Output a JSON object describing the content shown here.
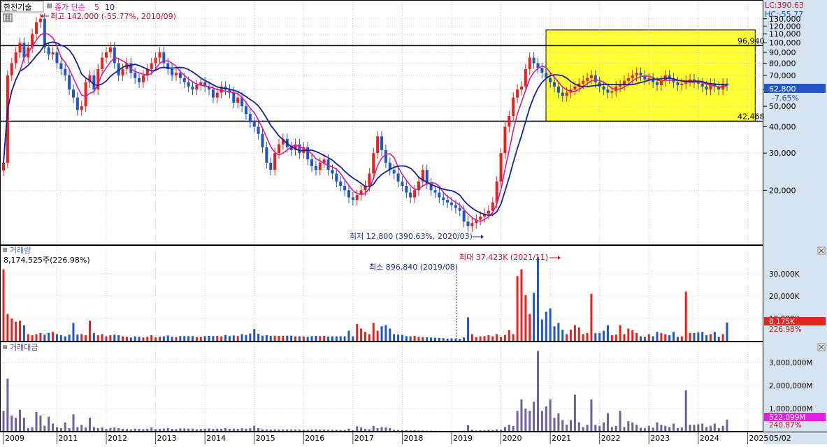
{
  "header": {
    "stock_name": "한전기술",
    "ma_legend_label": "종가 단순",
    "ma_periods": [
      "5",
      "10"
    ],
    "max_label": "최고 142,000 (-55.77%, 2010/09)",
    "min_label": "최저 12,800 (390.63%, 2020/03)",
    "lc_label": "LC:390.63",
    "hc_label": "HC:-55.77"
  },
  "colors": {
    "up": "#e8211e",
    "down": "#1f55c8",
    "ma5": "#d81aa8",
    "ma10": "#14238f",
    "highlight": "#ffff33",
    "price_badge": "#2356c5",
    "volume_badge": "#e0261e",
    "amount_badge": "#e020e0",
    "amount_bar": "#6f5f9a",
    "axis_bg": "#d6e4f1"
  },
  "price_panel": {
    "scale": "log",
    "ylim": [
      11500,
      150000
    ],
    "ticks": [
      {
        "v": 20000,
        "label": "20,000"
      },
      {
        "v": 30000,
        "label": "30,000"
      },
      {
        "v": 40000,
        "label": "40,000"
      },
      {
        "v": 50000,
        "label": "50,000"
      },
      {
        "v": 60000,
        "label": "60,000"
      },
      {
        "v": 70000,
        "label": "70,000"
      },
      {
        "v": 80000,
        "label": "80,000"
      },
      {
        "v": 90000,
        "label": "90,000"
      },
      {
        "v": 100000,
        "label": "100,000"
      },
      {
        "v": 110000,
        "label": "110,000"
      },
      {
        "v": 120000,
        "label": "120,000"
      },
      {
        "v": 130000,
        "label": "130,000"
      }
    ],
    "hlines": [
      {
        "value": 96940,
        "label": "96,940"
      },
      {
        "value": 42468,
        "label": "42,468"
      }
    ],
    "highlight_box": {
      "x_from": "2021/02",
      "x_to": "2025/02",
      "y_from": 42468,
      "y_to": 115000
    },
    "current_price": {
      "value": 62800,
      "label": "62,800",
      "change": "-7.65%"
    }
  },
  "volume_panel": {
    "title": "거래량",
    "current_label": "8,174,525주(226.98%)",
    "max_label": "최대 37,423K (2021/11)",
    "min_label": "최소 896,840 (2019/08)",
    "ylim": [
      0,
      40000
    ],
    "ticks": [
      {
        "v": 10000,
        "label": "10,000K"
      },
      {
        "v": 20000,
        "label": "20,000K"
      },
      {
        "v": 30000,
        "label": "30,000K"
      }
    ],
    "badge_value": "8,175K",
    "badge_pct": "226.98%"
  },
  "amount_panel": {
    "title": "거래대금",
    "ylim": [
      0,
      3700
    ],
    "ticks": [
      {
        "v": 1000,
        "label": "1,000,000M"
      },
      {
        "v": 2000,
        "label": "2,000,000M"
      },
      {
        "v": 3000,
        "label": "3,000,000M"
      }
    ],
    "badge_value": "522,099M",
    "badge_pct": "240.87%"
  },
  "x_axis": {
    "year_labels": [
      "2009",
      "2011",
      "2012",
      "2013",
      "2014",
      "2015",
      "2016",
      "2017",
      "2018",
      "2019",
      "2020",
      "2021",
      "2022",
      "2023",
      "2024",
      "2025"
    ],
    "last_date_label": "05/02"
  },
  "chart_data": {
    "type": "candlestick",
    "interval": "monthly",
    "start": "2009/12",
    "end": "2025/05",
    "scale": "log",
    "close": [
      27000,
      70000,
      80000,
      90000,
      100000,
      85000,
      95000,
      110000,
      125000,
      130000,
      95000,
      88000,
      90000,
      80000,
      75000,
      70000,
      60000,
      55000,
      48000,
      50000,
      65000,
      70000,
      60000,
      75000,
      85000,
      90000,
      95000,
      80000,
      70000,
      75000,
      80000,
      72000,
      68000,
      65000,
      70000,
      75000,
      80000,
      85000,
      90000,
      80000,
      75000,
      70000,
      72000,
      68000,
      65000,
      62000,
      60000,
      63000,
      65000,
      62000,
      60000,
      55000,
      58000,
      62000,
      60000,
      58000,
      52000,
      55000,
      50000,
      46000,
      42000,
      40000,
      37000,
      32000,
      27000,
      25000,
      30000,
      33000,
      35000,
      32000,
      31000,
      33000,
      30000,
      32000,
      28000,
      26000,
      25000,
      27000,
      28000,
      25000,
      24000,
      22000,
      21000,
      20000,
      18500,
      18000,
      19000,
      20000,
      21000,
      24000,
      30000,
      36000,
      31000,
      27000,
      25000,
      24000,
      22000,
      21000,
      19500,
      18500,
      20000,
      22000,
      25000,
      21500,
      20000,
      19500,
      18500,
      18000,
      17500,
      17000,
      16500,
      16000,
      14200,
      13500,
      14000,
      14500,
      15000,
      15500,
      16000,
      17500,
      22000,
      30000,
      40000,
      45000,
      55000,
      60000,
      62000,
      75000,
      85000,
      80000,
      76000,
      72000,
      68000,
      65000,
      62000,
      58000,
      56000,
      58000,
      60000,
      62000,
      64000,
      66000,
      68000,
      70000,
      65000,
      62000,
      60000,
      58000,
      59000,
      62000,
      63000,
      66000,
      68000,
      70000,
      72000,
      70000,
      67000,
      68000,
      65000,
      63000,
      66000,
      70000,
      68000,
      65000,
      63000,
      64000,
      66000,
      67000,
      65000,
      64000,
      62000,
      60000,
      64000,
      62000,
      60000,
      64000,
      62800
    ],
    "volume": [
      32000,
      12000,
      10000,
      8500,
      9000,
      7000,
      3000,
      2500,
      3000,
      3500,
      2800,
      3500,
      4000,
      3000,
      2500,
      2000,
      2800,
      8000,
      2800,
      3000,
      2500,
      9000,
      3500,
      2500,
      3000,
      2000,
      2500,
      2800,
      2500,
      2000,
      1800,
      1500,
      2000,
      1800,
      1500,
      1800,
      2500,
      1600,
      1800,
      2000,
      2400,
      1800,
      1700,
      2100,
      2100,
      2100,
      2100,
      1700,
      1800,
      2100,
      2200,
      2100,
      2200,
      2000,
      2600,
      2100,
      2400,
      2100,
      3000,
      2600,
      3300,
      5300,
      3200,
      2300,
      2500,
      2200,
      2300,
      2200,
      2200,
      2300,
      2300,
      2000,
      2000,
      2000,
      1800,
      2100,
      2200,
      2100,
      2200,
      1900,
      2000,
      2000,
      2000,
      2000,
      4500,
      2000,
      7500,
      5500,
      4000,
      3000,
      8000,
      4500,
      6500,
      7000,
      5500,
      3000,
      2800,
      2700,
      2100,
      2000,
      2200,
      1800,
      1700,
      1600,
      1500,
      1400,
      1300,
      1200,
      1000,
      1100,
      1000,
      900,
      1500,
      10500,
      3000,
      1700,
      2000,
      2100,
      2500,
      2000,
      3000,
      1800,
      2700,
      4800,
      3000,
      29000,
      32000,
      20500,
      12000,
      21500,
      37400,
      9500,
      13000,
      14500,
      6500,
      8000,
      5000,
      3000,
      5000,
      7000,
      6000,
      3000,
      3500,
      21000,
      3500,
      3500,
      4500,
      7000,
      2500,
      2800,
      7000,
      3000,
      5500,
      4800,
      3500,
      2000,
      1800,
      3000,
      2000,
      4000,
      3500,
      3000,
      2500,
      4000,
      1800,
      2000,
      22000,
      3500,
      3500,
      3800,
      4000,
      2500,
      3000,
      4000,
      1800,
      3000,
      8175
    ],
    "amount": [
      900,
      2300,
      700,
      600,
      950,
      600,
      150,
      200,
      850,
      700,
      250,
      650,
      350,
      200,
      150,
      400,
      150,
      750,
      200,
      300,
      180,
      600,
      200,
      150,
      180,
      120,
      160,
      180,
      150,
      120,
      110,
      100,
      130,
      120,
      110,
      120,
      180,
      110,
      120,
      130,
      150,
      120,
      110,
      140,
      140,
      130,
      130,
      100,
      120,
      130,
      140,
      120,
      130,
      120,
      150,
      120,
      130,
      120,
      150,
      130,
      150,
      250,
      150,
      100,
      100,
      90,
      100,
      95,
      95,
      100,
      100,
      90,
      90,
      85,
      80,
      90,
      95,
      90,
      90,
      80,
      80,
      75,
      70,
      70,
      130,
      60,
      230,
      180,
      120,
      100,
      250,
      150,
      200,
      180,
      150,
      80,
      70,
      65,
      60,
      55,
      60,
      50,
      50,
      45,
      45,
      40,
      35,
      30,
      25,
      30,
      25,
      25,
      40,
      280,
      80,
      50,
      60,
      65,
      80,
      70,
      100,
      80,
      200,
      300,
      250,
      900,
      1400,
      1000,
      900,
      1300,
      3500,
      900,
      1100,
      1400,
      600,
      800,
      500,
      300,
      500,
      1600,
      400,
      200,
      300,
      1400,
      300,
      250,
      400,
      800,
      200,
      250,
      900,
      200,
      450,
      400,
      300,
      170,
      150,
      250,
      170,
      400,
      300,
      250,
      200,
      350,
      150,
      180,
      1800,
      300,
      300,
      320,
      350,
      200,
      250,
      350,
      150,
      250,
      522
    ]
  }
}
